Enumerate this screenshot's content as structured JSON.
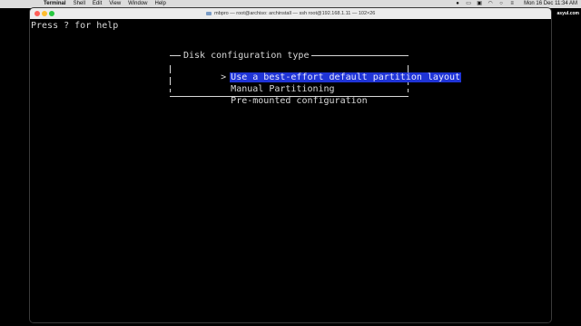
{
  "menubar": {
    "apple": "",
    "items": [
      "Terminal",
      "Shell",
      "Edit",
      "View",
      "Window",
      "Help"
    ],
    "clock": "Mon 16 Dec 11:34 AM",
    "status_icons": [
      "record-icon",
      "switch-icon",
      "lock-icon",
      "wifi-icon",
      "search-icon",
      "control-center-icon"
    ]
  },
  "window": {
    "title": "mbpro — root@archiso: archinstall — ssh root@192.168.1.11 — 102×26"
  },
  "terminal": {
    "help_text": "Press ? for help",
    "dialog": {
      "title": "Disk configuration type",
      "selected_marker": ">",
      "options": [
        "Use a best-effort default partition layout",
        "Manual Partitioning",
        "Pre-mounted configuration"
      ],
      "selected_index": 0
    }
  },
  "watermark": "asyul.com",
  "colors": {
    "selection_bg": "#1f34d6",
    "terminal_bg": "#000000",
    "terminal_fg": "#d8d8d8"
  }
}
